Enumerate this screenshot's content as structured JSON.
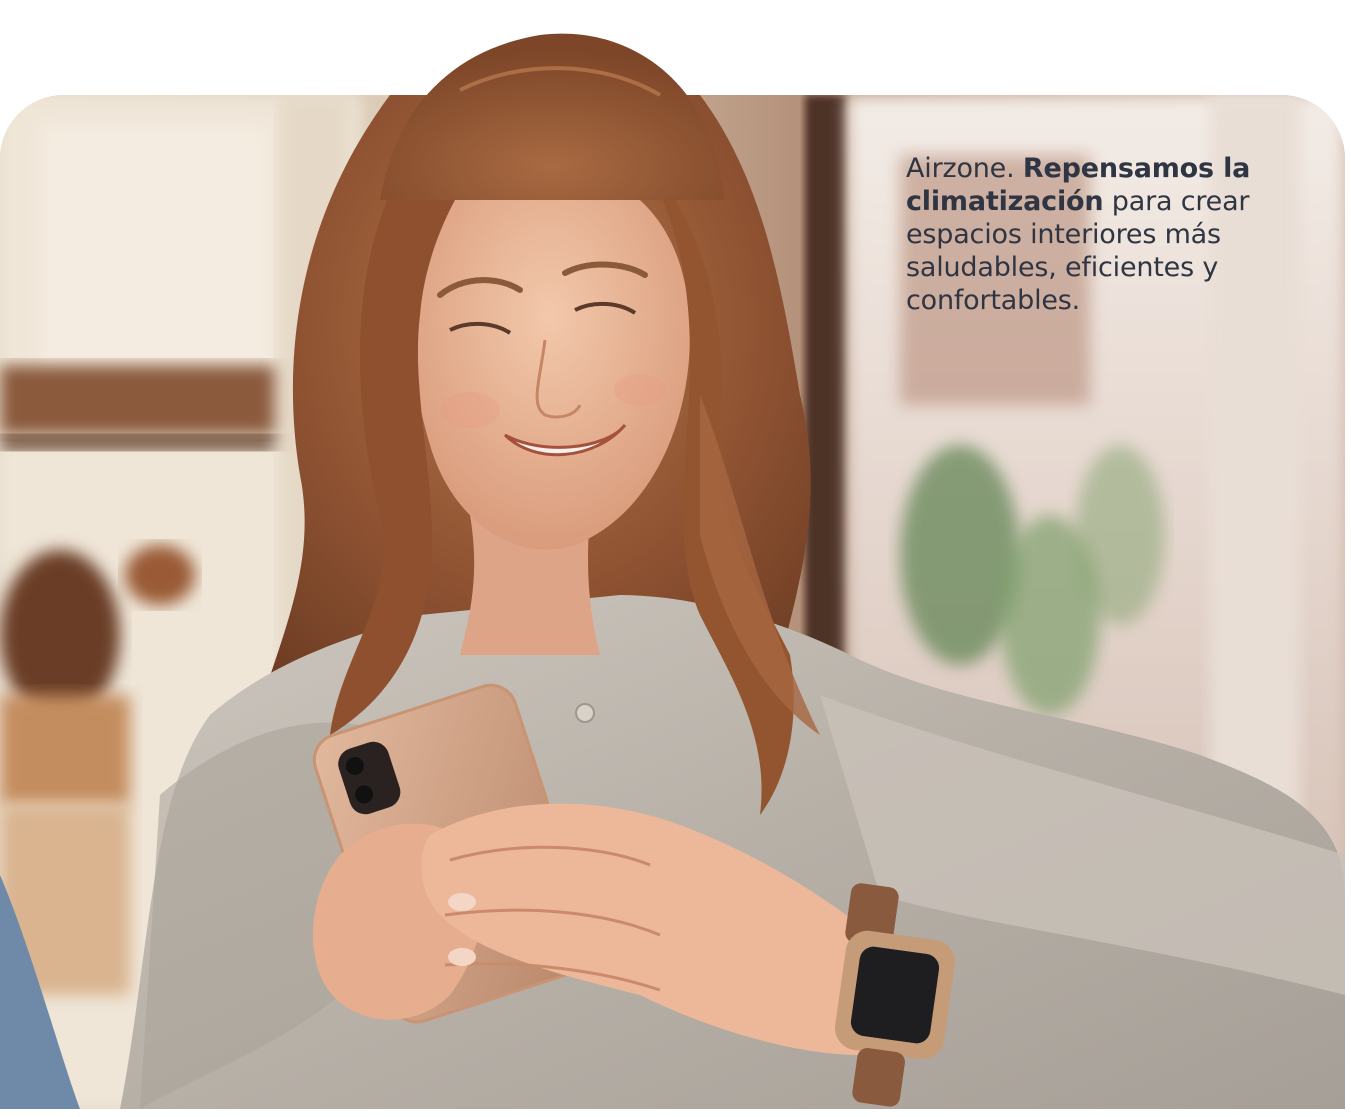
{
  "headline": {
    "brand": "Airzone.",
    "emphasis": "Repensamos la climatización",
    "rest": "para crear espacios interiores más saludables, eficientes y confortables."
  },
  "colors": {
    "text": "#2f3543",
    "background": "#ffffff",
    "hair": "#9a5a37",
    "shirt": "#bdb6ad",
    "skin": "#e9b595"
  },
  "image": {
    "subject": "woman smiling while using smartphone",
    "accessories": [
      "smartphone",
      "smartwatch"
    ]
  }
}
